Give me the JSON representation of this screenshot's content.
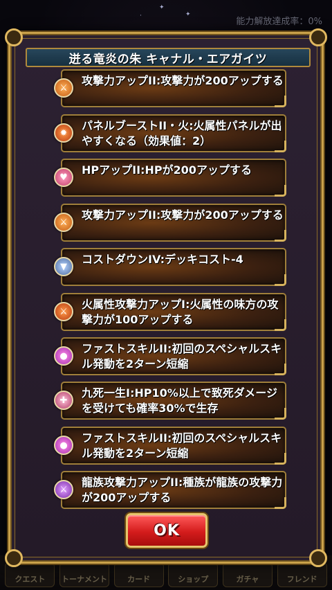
{
  "status": {
    "top_right_text": "能力解放達成率：0%"
  },
  "dialog": {
    "title": "迸る竜炎の朱 キャナル・エアガイツ",
    "skills": [
      {
        "icon": "attack-up-icon",
        "text": "攻撃力アップII:攻撃力が200アップする"
      },
      {
        "icon": "panel-boost-icon",
        "text": "パネルブーストII・火:火属性パネルが出やすくなる（効果値：2）"
      },
      {
        "icon": "hp-up-icon",
        "text": "HPアップII:HPが200アップする"
      },
      {
        "icon": "attack-up-icon",
        "text": "攻撃力アップII:攻撃力が200アップする"
      },
      {
        "icon": "cost-down-icon",
        "text": "コストダウンIV:デッキコスト-4"
      },
      {
        "icon": "fire-attack-up-icon",
        "text": "火属性攻撃力アップI:火属性の味方の攻撃力が100アップする"
      },
      {
        "icon": "fast-skill-icon",
        "text": "ファストスキルII:初回のスペシャルスキル発動を2ターン短縮"
      },
      {
        "icon": "survive-icon",
        "text": "九死一生I:HP10%以上で致死ダメージを受けても確率30%で生存"
      },
      {
        "icon": "fast-skill-icon",
        "text": "ファストスキルII:初回のスペシャルスキル発動を2ターン短縮"
      },
      {
        "icon": "dragon-attack-up-icon",
        "text": "龍族攻撃力アップII:種族が龍族の攻撃力が200アップする"
      }
    ],
    "ok_label": "OK"
  },
  "bottom_nav": {
    "items": [
      "クエスト",
      "トーナメント",
      "カード",
      "ショップ",
      "ガチャ",
      "フレンド"
    ]
  },
  "colors": {
    "frame_gold": "#c9a14a",
    "title_bg": "#1f3d52",
    "ok_red": "#d41c1c"
  }
}
